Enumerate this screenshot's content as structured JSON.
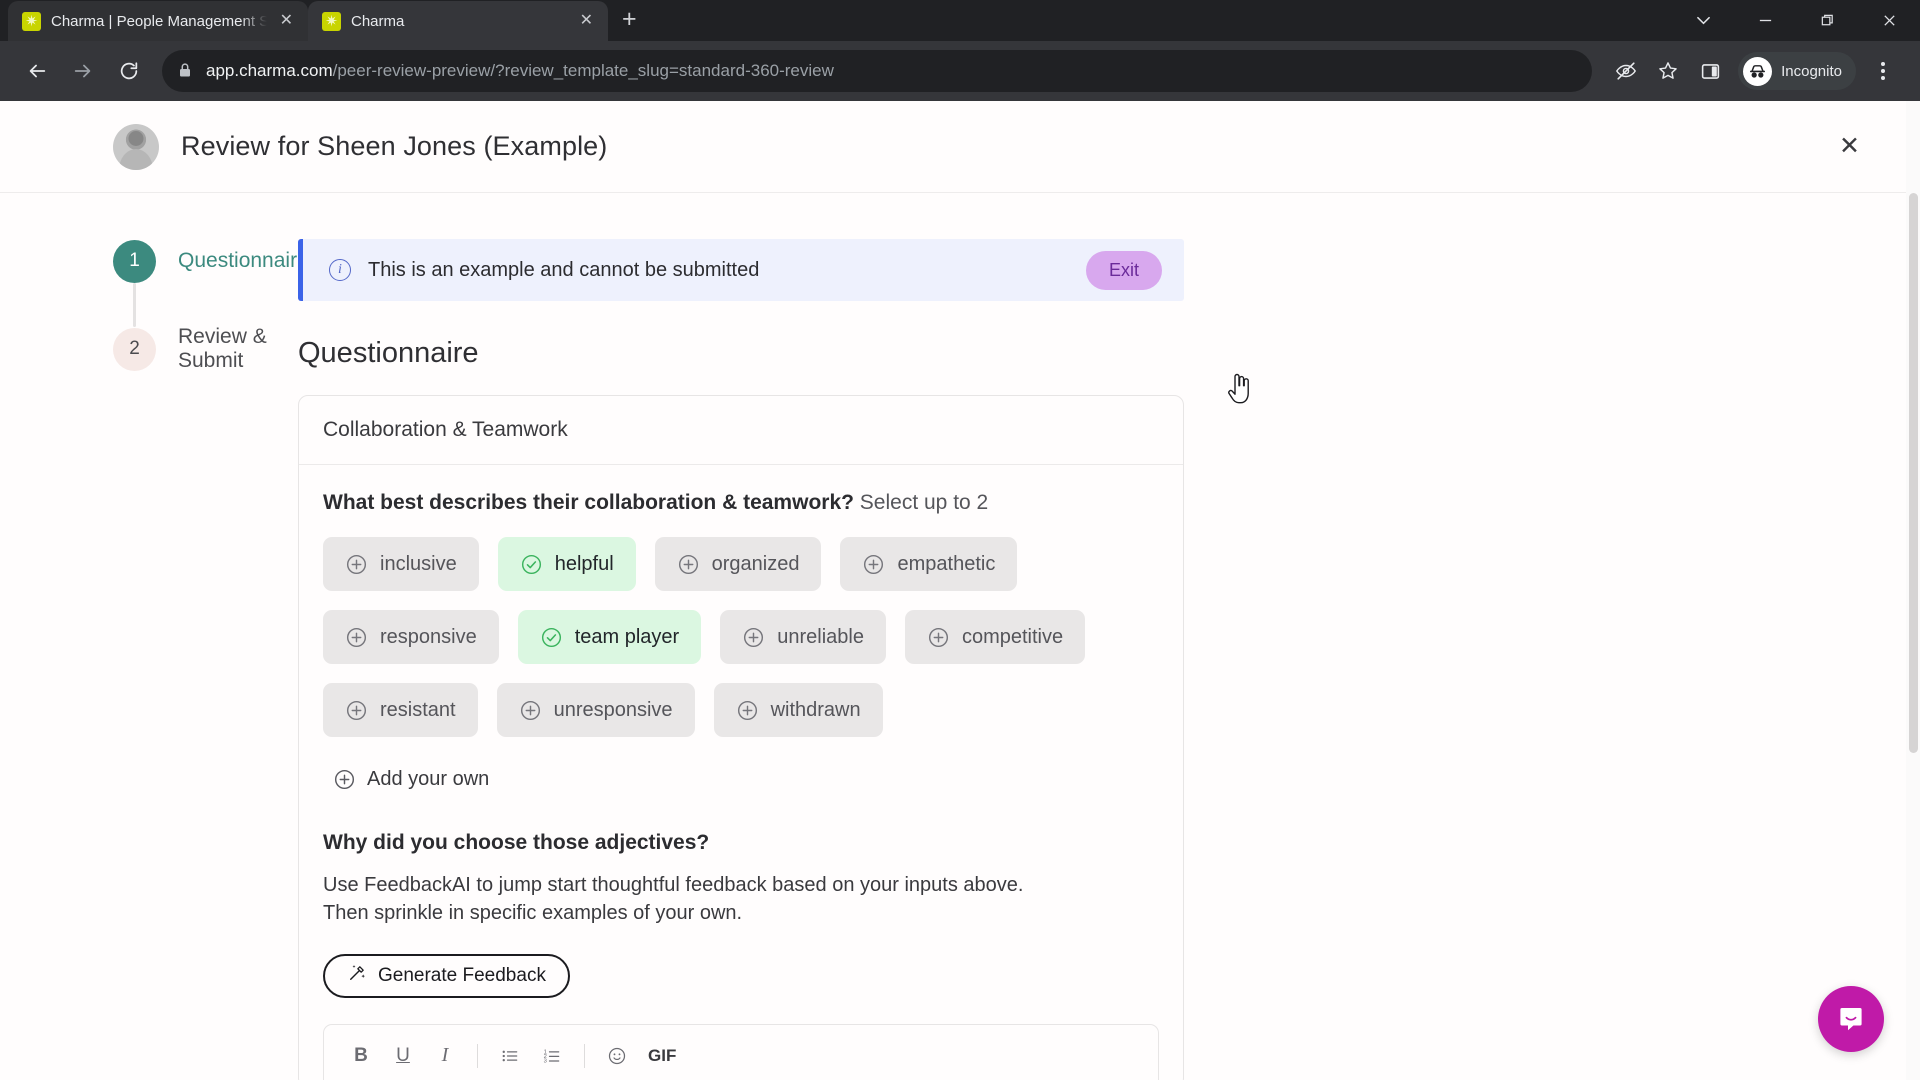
{
  "browser": {
    "tabs": [
      {
        "title": "Charma | People Management S",
        "favicon": "charma-star-icon",
        "active": false
      },
      {
        "title": "Charma",
        "favicon": "charma-star-icon",
        "active": true
      }
    ],
    "new_tab_label": "+",
    "window_controls": {
      "tab_search": "⌄",
      "minimize": "−",
      "maximize": "❐",
      "close": "✕"
    },
    "nav": {
      "back": "←",
      "forward": "→",
      "reload": "↻"
    },
    "omnibox": {
      "lock_icon": "lock-icon",
      "url_host": "app.charma.com",
      "url_path": "/peer-review-preview/?review_template_slug=standard-360-review",
      "full_url": "app.charma.com/peer-review-preview/?review_template_slug=standard-360-review"
    },
    "toolbar_icons": [
      "third-party-cookie-blocked-icon",
      "bookmark-star-icon",
      "side-panel-icon"
    ],
    "profile": {
      "label": "Incognito",
      "icon": "incognito-icon"
    },
    "menu_icon": "three-dot-menu-icon"
  },
  "page": {
    "header": {
      "title": "Review for Sheen Jones (Example)",
      "avatar": "user-avatar",
      "close_label": "✕"
    },
    "stepper": [
      {
        "number": "1",
        "label": "Questionnaire",
        "state": "active"
      },
      {
        "number": "2",
        "label": "Review & Submit",
        "state": "upcoming"
      }
    ],
    "alert": {
      "icon": "info-icon",
      "message": "This is an example and cannot be submitted",
      "button_label": "Exit",
      "accent_color": "#3b63e8",
      "background_color": "#eef1fd",
      "button_color": "#d8a8ee"
    },
    "section_title": "Questionnaire",
    "card": {
      "title": "Collaboration & Teamwork",
      "question1": {
        "prompt": "What best describes their collaboration & teamwork?",
        "hint": "Select up to 2",
        "chip_rows": [
          [
            {
              "label": "inclusive",
              "selected": false
            },
            {
              "label": "helpful",
              "selected": true
            },
            {
              "label": "organized",
              "selected": false
            },
            {
              "label": "empathetic",
              "selected": false
            }
          ],
          [
            {
              "label": "responsive",
              "selected": false
            },
            {
              "label": "team player",
              "selected": true
            },
            {
              "label": "unreliable",
              "selected": false
            },
            {
              "label": "competitive",
              "selected": false
            }
          ],
          [
            {
              "label": "resistant",
              "selected": false
            },
            {
              "label": "unresponsive",
              "selected": false
            },
            {
              "label": "withdrawn",
              "selected": false
            }
          ]
        ],
        "add_own_label": "Add your own",
        "selected_color": "#dbf7e1",
        "unselected_color": "#e9e7e7"
      },
      "question2": {
        "prompt": "Why did you choose those adjectives?",
        "description_line1": "Use FeedbackAI to jump start thoughtful feedback based on your inputs above.",
        "description_line2": "Then sprinkle in specific examples of your own.",
        "generate_button": "Generate Feedback",
        "generate_icon": "magic-wand-icon"
      },
      "editor_toolbar": [
        {
          "name": "bold",
          "glyph": "B"
        },
        {
          "name": "underline",
          "glyph": "U"
        },
        {
          "name": "italic",
          "glyph": "I"
        },
        {
          "name": "separator",
          "glyph": ""
        },
        {
          "name": "bulleted-list",
          "glyph": ""
        },
        {
          "name": "numbered-list",
          "glyph": ""
        },
        {
          "name": "separator",
          "glyph": ""
        },
        {
          "name": "emoji",
          "glyph": "☺"
        },
        {
          "name": "gif",
          "glyph": "GIF"
        }
      ]
    },
    "support_widget": {
      "name": "intercom-messenger",
      "color": "#c01aa8"
    }
  }
}
